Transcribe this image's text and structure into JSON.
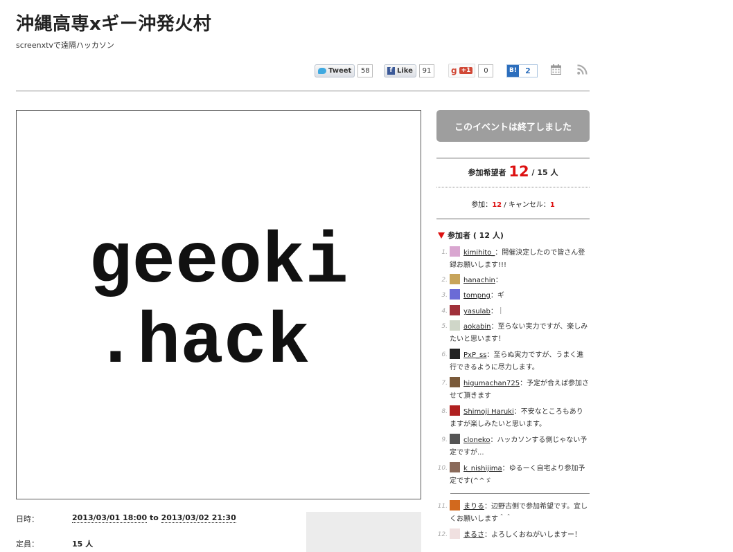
{
  "header": {
    "title": "沖縄高専xギー沖発火村",
    "subtitle": "screenxtvで遠隔ハッカソン"
  },
  "social": {
    "tweet_label": "Tweet",
    "tweet_count": "58",
    "like_label": "Like",
    "like_count": "91",
    "gplus_label": "+1",
    "gplus_count": "0",
    "hatena_label": "B!",
    "hatena_count": "2"
  },
  "icons": {
    "calendar": "calendar-icon",
    "rss": "rss-icon"
  },
  "event_image": {
    "line1": "geeoki",
    "line2": ".hack"
  },
  "info": {
    "date_label": "日時：",
    "date_start": "2013/03/01 18:00",
    "date_to": "to",
    "date_end": "2013/03/02 21:30",
    "capacity_label": "定員：",
    "capacity_value": "15 人"
  },
  "sidebar": {
    "status_button": "このイベントは終了しました",
    "applicants_label": "参加希望者",
    "applicants_count": "12",
    "applicants_total": "/ 15 人",
    "participation_label": "参加：",
    "participation_count": "12",
    "cancel_label": " / キャンセル：",
    "cancel_count": "1",
    "participants_heading": "参加者 ( 12 人)",
    "participants": [
      {
        "num": "1.",
        "name": "kimihito_",
        "comment": "：開催決定したので皆さん登",
        "comment2": "録お願いします!!!",
        "color": "#d9a6d0"
      },
      {
        "num": "2.",
        "name": "hanachin",
        "comment": "：",
        "comment2": "",
        "color": "#c7a45a"
      },
      {
        "num": "3.",
        "name": "tompng",
        "comment": "：ギ",
        "comment2": "",
        "color": "#6b6bd6"
      },
      {
        "num": "4.",
        "name": "yasulab",
        "comment": "：｜",
        "comment2": "",
        "color": "#a0303a"
      },
      {
        "num": "5.",
        "name": "aokabin",
        "comment": "：至らない実力ですが、楽しみ",
        "comment2": "たいと思います！",
        "color": "#cfd6c8"
      },
      {
        "num": "6.",
        "name": "PxP_ss",
        "comment": "：至らぬ実力ですが、うまく進",
        "comment2": "行できるように尽力します。",
        "color": "#222222"
      },
      {
        "num": "7.",
        "name": "higumachan725",
        "comment": "：予定が合えば参加さ",
        "comment2": "せて頂きます",
        "color": "#7a5a3a"
      },
      {
        "num": "8.",
        "name": "Shimoji Haruki",
        "comment": "：不安なところもあり",
        "comment2": "ますが楽しみたいと思います。",
        "color": "#b02020"
      },
      {
        "num": "9.",
        "name": "cloneko",
        "comment": "：ハッカソンする側じゃない予",
        "comment2": "定ですが...",
        "color": "#555555"
      },
      {
        "num": "10.",
        "name": "k_nishijima",
        "comment": "：ゆるーく自宅より参加予",
        "comment2": "定です(^^ゞ",
        "color": "#8a6a5a"
      },
      {
        "num": "11.",
        "name": "まりる",
        "comment": "：辺野古側で参加希望です。宜し",
        "comment2": "くお願いします＾＾",
        "color": "#d2691e"
      },
      {
        "num": "12.",
        "name": "まるさ",
        "comment": "：よろしくおねがいしますー！",
        "comment2": "",
        "color": "#f0e0e0"
      }
    ]
  }
}
